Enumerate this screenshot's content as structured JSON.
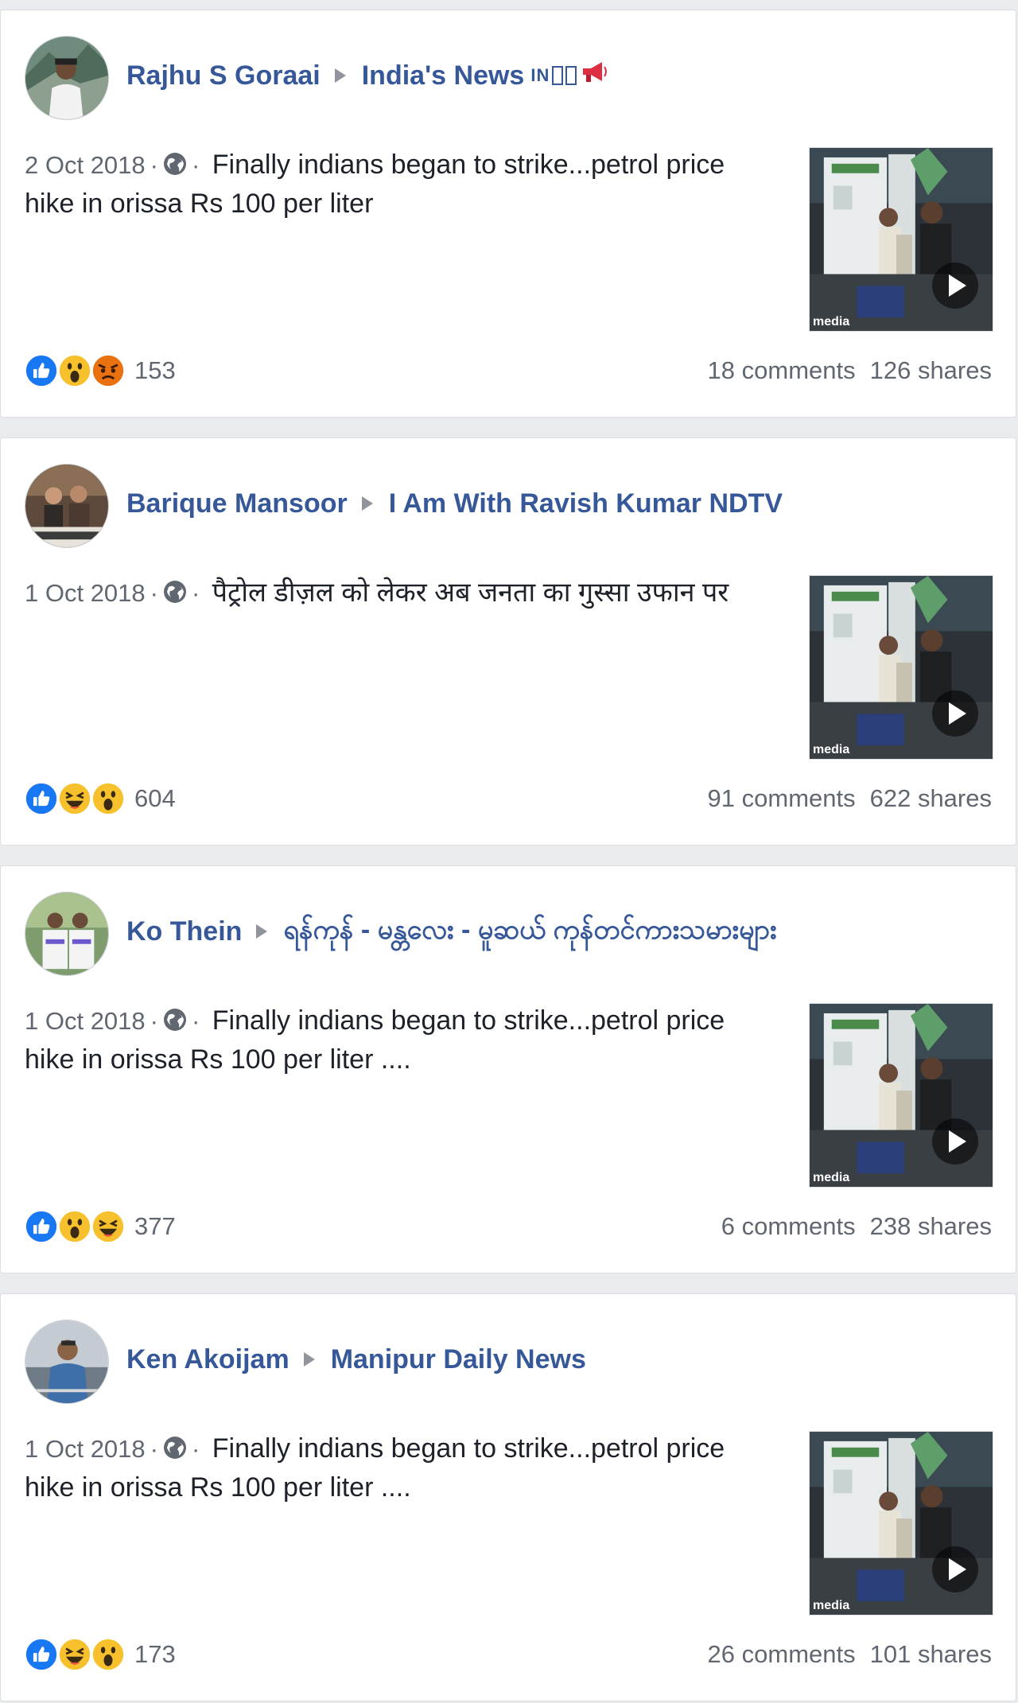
{
  "posts": [
    {
      "author": "Rajhu S Goraai",
      "group": "India's News",
      "group_suffix": "IN",
      "group_has_icons": true,
      "date": "2 Oct 2018",
      "text": "Finally indians began to strike...petrol price hike in orissa Rs 100 per liter",
      "thumb_label": "media",
      "reactions": [
        "like-icon",
        "wow-icon",
        "angry-icon"
      ],
      "reaction_count": "153",
      "comments": "18 comments",
      "shares": "126 shares"
    },
    {
      "author": "Barique Mansoor",
      "group": "I Am With Ravish Kumar NDTV",
      "group_suffix": "",
      "group_has_icons": false,
      "date": "1 Oct 2018",
      "text": "पैट्रोल डीज़ल को लेकर अब जनता का गुस्सा उफान पर",
      "thumb_label": "media",
      "reactions": [
        "like-icon",
        "haha-icon",
        "wow-icon"
      ],
      "reaction_count": "604",
      "comments": "91 comments",
      "shares": "622 shares"
    },
    {
      "author": "Ko Thein",
      "group": "ရန်ကုန် - မန္တလေး - မူဆယ် ကုန်တင်ကားသမားများ",
      "group_suffix": "",
      "group_has_icons": false,
      "date": "1 Oct 2018",
      "text": "Finally indians began to strike...petrol price hike in orissa Rs 100 per liter ....",
      "thumb_label": "media",
      "reactions": [
        "like-icon",
        "wow-icon",
        "haha-icon"
      ],
      "reaction_count": "377",
      "comments": "6 comments",
      "shares": "238 shares"
    },
    {
      "author": "Ken Akoijam",
      "group": "Manipur Daily News",
      "group_suffix": "",
      "group_has_icons": false,
      "date": "1 Oct 2018",
      "text": "Finally indians began to strike...petrol price hike in orissa Rs 100 per liter ....",
      "thumb_label": "media",
      "reactions": [
        "like-icon",
        "haha-icon",
        "wow-icon"
      ],
      "reaction_count": "173",
      "comments": "26 comments",
      "shares": "101 shares"
    }
  ],
  "colors": {
    "link": "#365899",
    "meta": "#616770",
    "like": "#1877f2",
    "yellow": "#f7c12d",
    "angry": "#e9710f"
  }
}
